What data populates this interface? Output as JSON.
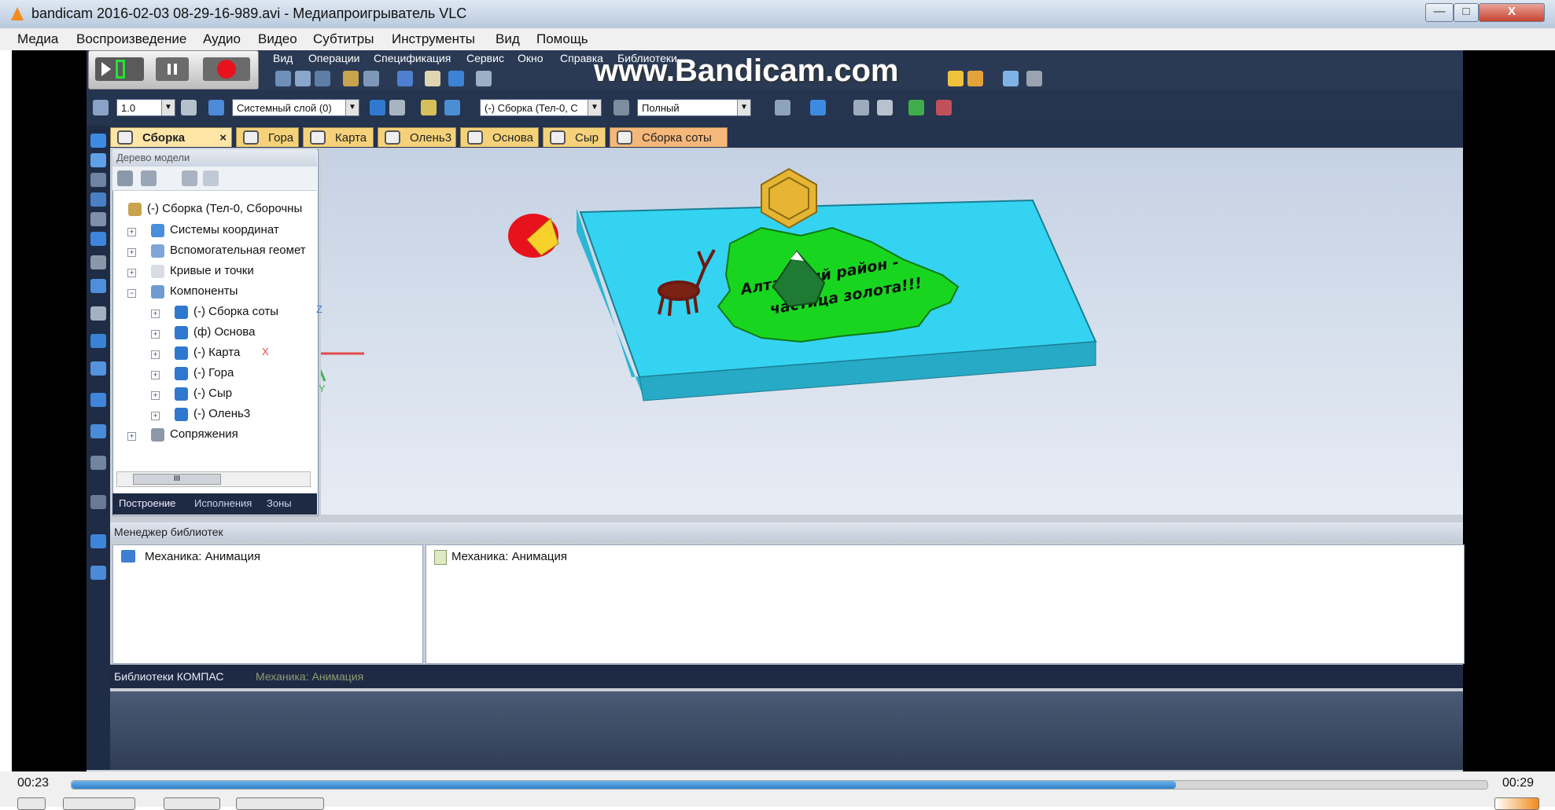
{
  "window": {
    "title": "bandicam 2016-02-03 08-29-16-989.avi - Медиапроигрыватель VLC",
    "controls": [
      "—",
      "□",
      "X"
    ]
  },
  "vlc_menu": [
    "Медиа",
    "Воспроизведение",
    "Аудио",
    "Видео",
    "Субтитры",
    "Инструменты",
    "Вид",
    "Помощь"
  ],
  "kompas": {
    "menu": [
      "Вид",
      "Операции",
      "Спецификация",
      "Сервис",
      "Окно",
      "Справка",
      "Библиотеки"
    ],
    "watermark": "www.Bandicam.com",
    "toolbar": {
      "scale_value": "1.0",
      "layer": "Системный слой (0)",
      "assembly": "(-) Сборка (Тел-0, С",
      "view_mode": "Полный"
    },
    "doc_tabs": [
      "Сборка",
      "Гора",
      "Карта",
      "Олень3",
      "Основа",
      "Сыр",
      "Сборка соты"
    ],
    "tree": {
      "title": "Дерево модели",
      "nodes": [
        {
          "label": "(-) Сборка (Тел-0, Сборочны"
        },
        {
          "label": "Системы координат"
        },
        {
          "label": "Вспомогательная геомет"
        },
        {
          "label": "Кривые и точки"
        },
        {
          "label": "Компоненты"
        },
        {
          "label": "(-) Сборка соты"
        },
        {
          "label": "(ф) Основа"
        },
        {
          "label": "(-) Карта"
        },
        {
          "label": "(-) Гора"
        },
        {
          "label": "(-) Сыр"
        },
        {
          "label": "(-) Олень3"
        },
        {
          "label": "Сопряжения"
        }
      ],
      "scroll_label": "III",
      "tabs": [
        "Построение",
        "Исполнения",
        "Зоны"
      ]
    },
    "model_text": {
      "line1": "Алтайский район -",
      "line2": "частица золота!!!"
    },
    "axes": {
      "x": "X",
      "y": "Y",
      "z": "Z"
    },
    "library_manager": {
      "title": "Менеджер библиотек",
      "left_item": "Механика: Анимация",
      "right_item": "Механика: Анимация",
      "tabs": [
        "Библиотеки КОМПАС",
        "Механика: Анимация"
      ]
    },
    "colors": {
      "plate_top": "#34d3f1",
      "plate_side": "#2bb6d4",
      "map_green": "#18d620",
      "honeycomb": "#e5b533",
      "cheese_red": "#e8121d",
      "mountain": "#1f7a33"
    }
  },
  "player": {
    "elapsed": "00:23",
    "total": "00:29",
    "progress": 0.78
  }
}
